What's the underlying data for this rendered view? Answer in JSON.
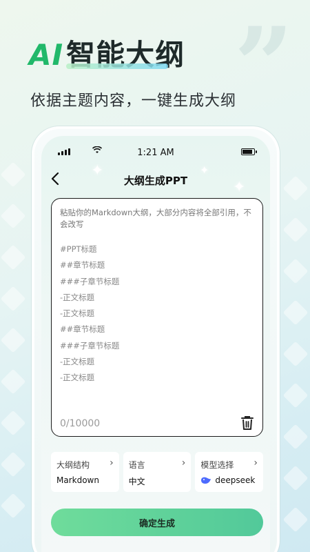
{
  "promo": {
    "title_ai": "AI",
    "title_rest": "智能大纲",
    "subtitle": "依据主题内容，一键生成大纲"
  },
  "status_bar": {
    "time": "1:21 AM"
  },
  "nav": {
    "title": "大纲生成PPT"
  },
  "editor": {
    "placeholder": "粘贴你的Markdown大纲，大部分内容将全部引用，不会改写",
    "example_lines": [
      "#PPT标题",
      "##章节标题",
      "###子章节标题",
      "-正文标题",
      "-正文标题",
      "##章节标题",
      "###子章节标题",
      "-正文标题",
      "-正文标题"
    ],
    "char_count": "0/10000"
  },
  "options": [
    {
      "label": "大纲结构",
      "value": "Markdown",
      "icon": ""
    },
    {
      "label": "语言",
      "value": "中文",
      "icon": ""
    },
    {
      "label": "模型选择",
      "value": "deepseek",
      "icon": "deepseek-whale-icon"
    }
  ],
  "confirm_label": "确定生成",
  "colors": {
    "accent_green": "#21b86a",
    "button_start": "#6fdc9b",
    "button_end": "#52c99a",
    "deepseek_blue": "#4d6bfe"
  }
}
